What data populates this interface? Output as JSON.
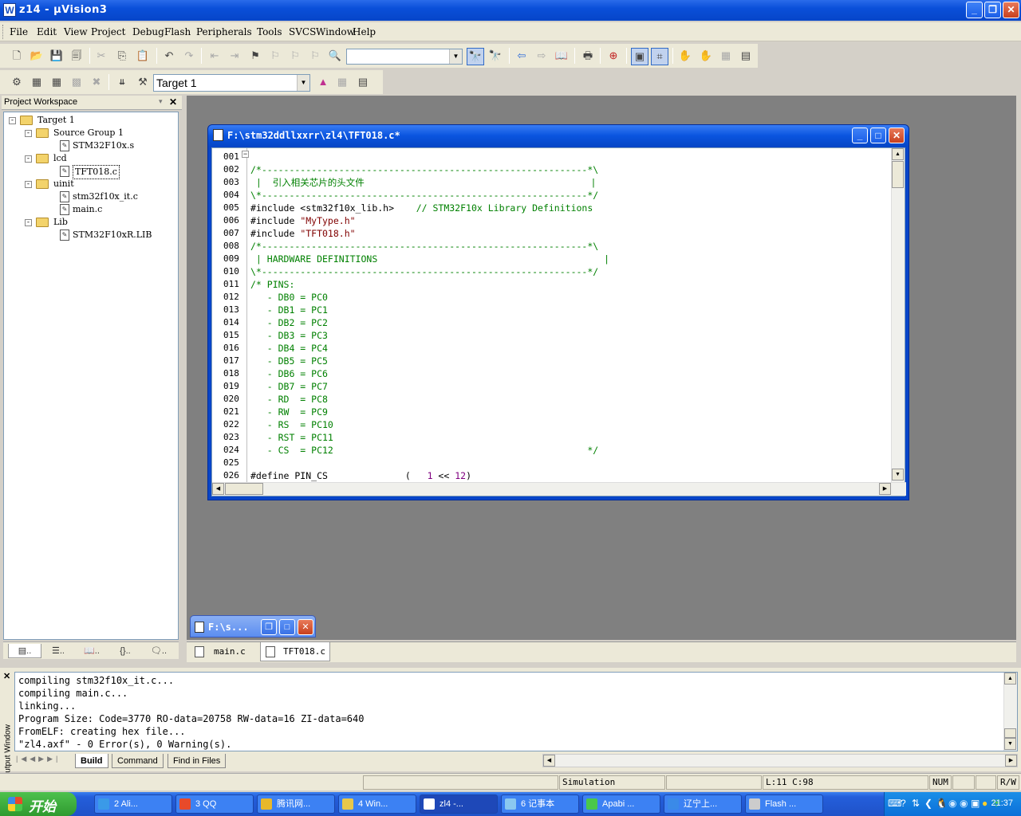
{
  "window": {
    "title": "z14  - µVision3",
    "logo": "W"
  },
  "menu": [
    "File",
    "Edit",
    "View",
    "Project",
    "Debug",
    "Flash",
    "Peripherals",
    "Tools",
    "SVCS",
    "Window",
    "Help"
  ],
  "toolbar": {
    "find_value": "",
    "target_value": "Target 1"
  },
  "workspace": {
    "title": "Project Workspace",
    "tree": [
      {
        "label": "Target 1",
        "level": 0,
        "type": "target",
        "exp": "-"
      },
      {
        "label": "Source Group 1",
        "level": 1,
        "type": "folder",
        "exp": "-"
      },
      {
        "label": "STM32F10x.s",
        "level": 2,
        "type": "file"
      },
      {
        "label": "lcd",
        "level": 1,
        "type": "folder",
        "exp": "-"
      },
      {
        "label": "TFT018.c",
        "level": 2,
        "type": "file",
        "selected": true
      },
      {
        "label": "uinit",
        "level": 1,
        "type": "folder",
        "exp": "-"
      },
      {
        "label": "stm32f10x_it.c",
        "level": 2,
        "type": "file"
      },
      {
        "label": "main.c",
        "level": 2,
        "type": "file"
      },
      {
        "label": "Lib",
        "level": 1,
        "type": "folder",
        "exp": "-"
      },
      {
        "label": "STM32F10xR.LIB",
        "level": 2,
        "type": "file"
      }
    ],
    "tabs": [
      "..",
      "..",
      "..",
      "..",
      ".."
    ]
  },
  "editor": {
    "title": "F:\\stm32ddllxxrr\\zl4\\TFT018.c*",
    "lines": [
      {
        "n": "001",
        "parts": []
      },
      {
        "n": "002",
        "parts": [
          {
            "t": "/*-----------------------------------------------------------*\\",
            "c": "cm"
          }
        ]
      },
      {
        "n": "003",
        "parts": [
          {
            "t": " |  引入相关芯片的头文件                                         |",
            "c": "cm"
          }
        ]
      },
      {
        "n": "004",
        "parts": [
          {
            "t": "\\*-----------------------------------------------------------*/",
            "c": "cm"
          }
        ]
      },
      {
        "n": "005",
        "parts": [
          {
            "t": "#include <stm32f10x_lib.h>    ",
            "c": ""
          },
          {
            "t": "// STM32F10x Library Definitions",
            "c": "cm"
          }
        ]
      },
      {
        "n": "006",
        "parts": [
          {
            "t": "#include ",
            "c": ""
          },
          {
            "t": "\"MyType.h\"",
            "c": "st"
          }
        ]
      },
      {
        "n": "007",
        "parts": [
          {
            "t": "#include ",
            "c": ""
          },
          {
            "t": "\"TFT018.h\"",
            "c": "st"
          }
        ]
      },
      {
        "n": "008",
        "parts": [
          {
            "t": "/*-----------------------------------------------------------*\\",
            "c": "cm"
          }
        ]
      },
      {
        "n": "009",
        "parts": [
          {
            "t": " | HARDWARE DEFINITIONS                                         |",
            "c": "cm"
          }
        ]
      },
      {
        "n": "010",
        "parts": [
          {
            "t": "\\*-----------------------------------------------------------*/",
            "c": "cm"
          }
        ]
      },
      {
        "n": "011",
        "parts": [
          {
            "t": "/* PINS:",
            "c": "cm"
          }
        ]
      },
      {
        "n": "012",
        "parts": [
          {
            "t": "   - DB0 = PC0",
            "c": "cm"
          }
        ]
      },
      {
        "n": "013",
        "parts": [
          {
            "t": "   - DB1 = PC1",
            "c": "cm"
          }
        ]
      },
      {
        "n": "014",
        "parts": [
          {
            "t": "   - DB2 = PC2",
            "c": "cm"
          }
        ]
      },
      {
        "n": "015",
        "parts": [
          {
            "t": "   - DB3 = PC3",
            "c": "cm"
          }
        ]
      },
      {
        "n": "016",
        "parts": [
          {
            "t": "   - DB4 = PC4",
            "c": "cm"
          }
        ]
      },
      {
        "n": "017",
        "parts": [
          {
            "t": "   - DB5 = PC5",
            "c": "cm"
          }
        ]
      },
      {
        "n": "018",
        "parts": [
          {
            "t": "   - DB6 = PC6",
            "c": "cm"
          }
        ]
      },
      {
        "n": "019",
        "parts": [
          {
            "t": "   - DB7 = PC7",
            "c": "cm"
          }
        ]
      },
      {
        "n": "020",
        "parts": [
          {
            "t": "   - RD  = PC8",
            "c": "cm"
          }
        ]
      },
      {
        "n": "021",
        "parts": [
          {
            "t": "   - RW  = PC9",
            "c": "cm"
          }
        ]
      },
      {
        "n": "022",
        "parts": [
          {
            "t": "   - RS  = PC10",
            "c": "cm"
          }
        ]
      },
      {
        "n": "023",
        "parts": [
          {
            "t": "   - RST = PC11",
            "c": "cm"
          }
        ]
      },
      {
        "n": "024",
        "parts": [
          {
            "t": "   - CS  = PC12                                              */",
            "c": "cm"
          }
        ]
      },
      {
        "n": "025",
        "parts": []
      },
      {
        "n": "026",
        "parts": [
          {
            "t": "#define PIN_CS              (   ",
            "c": ""
          },
          {
            "t": "1",
            "c": "num"
          },
          {
            "t": " << ",
            "c": ""
          },
          {
            "t": "12",
            "c": "num"
          },
          {
            "t": ")",
            "c": ""
          }
        ]
      }
    ]
  },
  "minimized": {
    "title": "F:\\s..."
  },
  "doc_tabs": [
    "main.c",
    "TFT018.c"
  ],
  "output": {
    "side_label": "Output Window",
    "lines": [
      "compiling stm32f10x_it.c...",
      "compiling main.c...",
      "linking...",
      "Program Size: Code=3770 RO-data=20758 RW-data=16 ZI-data=640",
      "FromELF: creating hex file...",
      "\"zl4.axf\" - 0 Error(s), 0 Warning(s)."
    ],
    "tabs": [
      "Build",
      "Command",
      "Find in Files"
    ]
  },
  "status": {
    "mode": "Simulation",
    "position": "L:11 C:98",
    "num": "NUM",
    "rw": "R/W"
  },
  "taskbar": {
    "start": "开始",
    "tasks": [
      {
        "label": "2 Ali...",
        "color": "#3a9ae8"
      },
      {
        "label": "3 QQ",
        "color": "#e84a2a"
      },
      {
        "label": "腾讯网...",
        "color": "#e8b82a"
      },
      {
        "label": "4 Win...",
        "color": "#e8c84a"
      },
      {
        "label": "zl4  -...",
        "color": "#ffffff"
      },
      {
        "label": "6 记事本",
        "color": "#8ac8f0"
      },
      {
        "label": "Apabi ...",
        "color": "#4ac84a"
      },
      {
        "label": "辽宁上...",
        "color": "#3a8ae8"
      },
      {
        "label": "Flash ...",
        "color": "#cccccc"
      }
    ],
    "clock": "21:37"
  }
}
